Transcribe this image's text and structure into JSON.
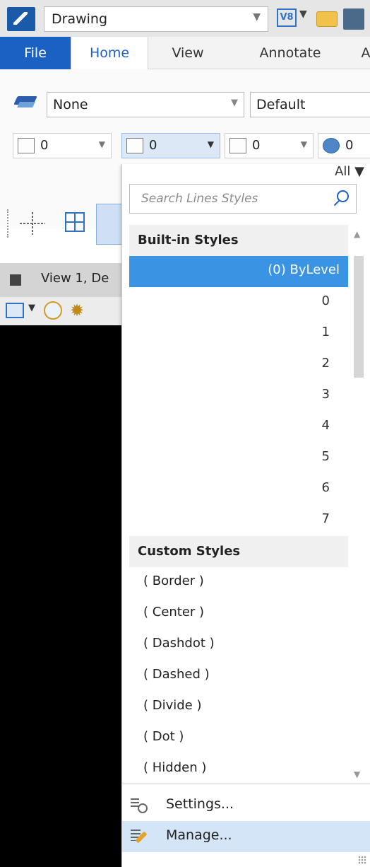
{
  "titlebar": {
    "workflow_value": "Drawing",
    "v8_icon_text": "V8"
  },
  "tabs": {
    "file": "File",
    "home": "Home",
    "view": "View",
    "annotate": "Annotate",
    "extra": "A"
  },
  "ribbon": {
    "level_value": "None",
    "text_style_value": "Default",
    "color_value": "0",
    "line_style_value": "0",
    "line_weight_value": "0",
    "transparency_value": "0"
  },
  "view": {
    "title": "View 1, De"
  },
  "line_style_picker": {
    "filter_label": "All ▼",
    "search_placeholder": "Search Lines Styles",
    "builtin_header": "Built-in Styles",
    "builtin_items": [
      {
        "label": "(0) ByLevel",
        "pattern": "solid",
        "selected": true
      },
      {
        "label": "0",
        "pattern": "solid"
      },
      {
        "label": "1",
        "pattern": "dotted"
      },
      {
        "label": "2",
        "pattern": "dash"
      },
      {
        "label": "3",
        "pattern": "longdash"
      },
      {
        "label": "4",
        "pattern": "dashdot"
      },
      {
        "label": "5",
        "pattern": "shortdash"
      },
      {
        "label": "6",
        "pattern": "dashdotdot"
      },
      {
        "label": "7",
        "pattern": "dashdot2"
      }
    ],
    "custom_header": "Custom Styles",
    "custom_items": [
      {
        "label": "( Border )"
      },
      {
        "label": "( Center )"
      },
      {
        "label": "( Dashdot )"
      },
      {
        "label": "( Dashed )"
      },
      {
        "label": "( Divide )"
      },
      {
        "label": "( Dot )"
      },
      {
        "label": "( Hidden )"
      }
    ],
    "footer": {
      "settings_label": "Settings...",
      "manage_label": "Manage..."
    }
  }
}
